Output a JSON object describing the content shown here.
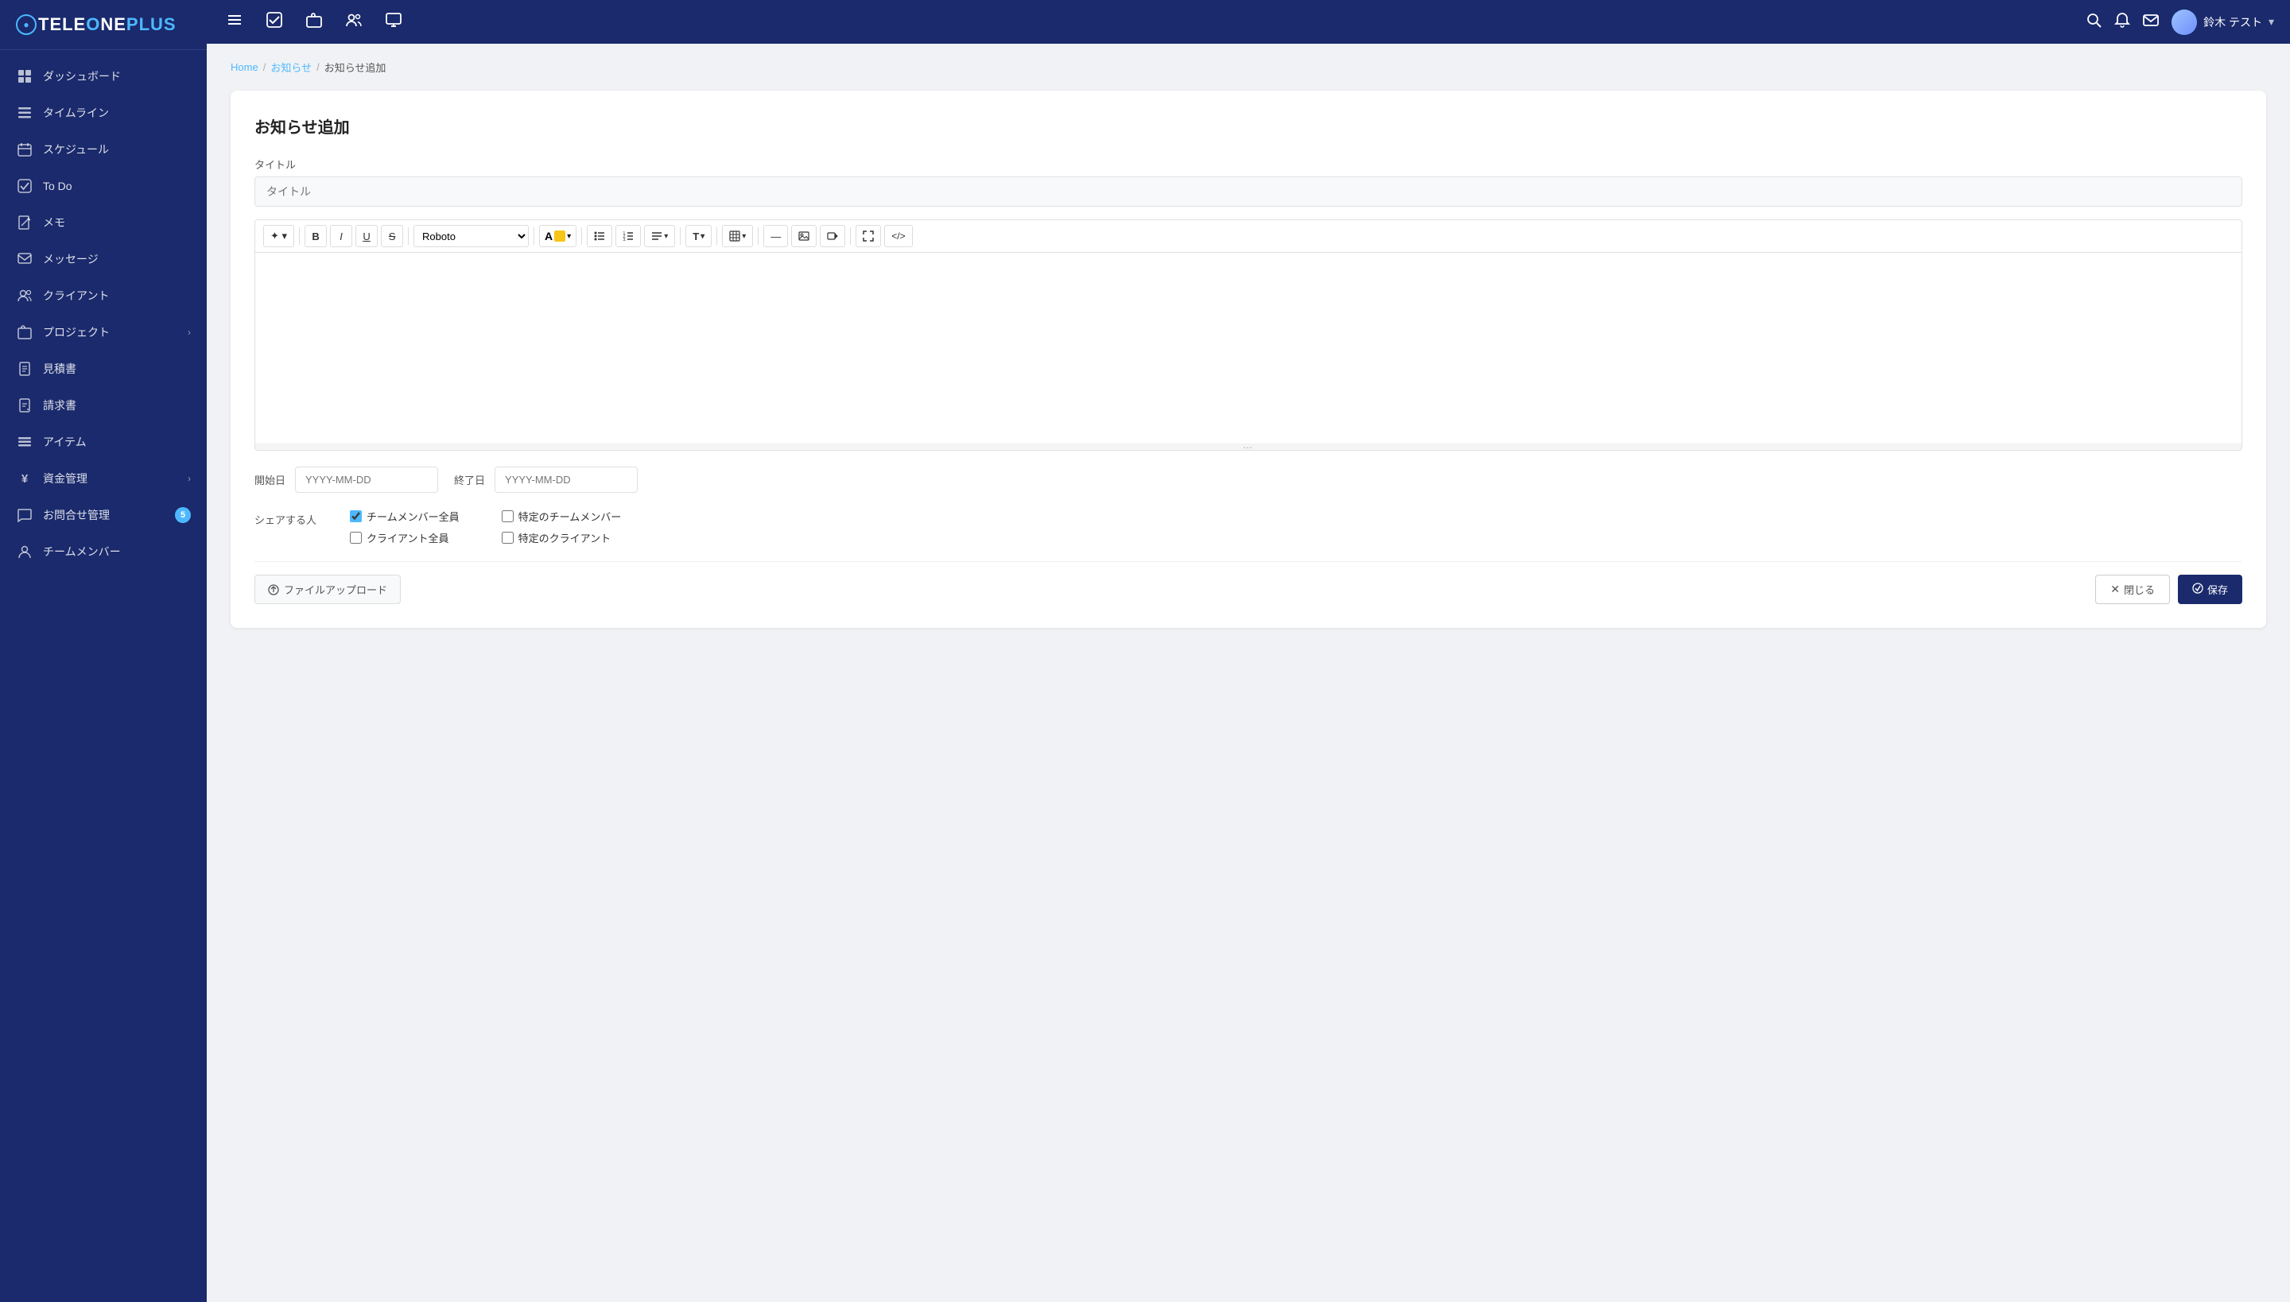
{
  "brand": {
    "name_part1": "TELE",
    "name_part2": "NE",
    "name_part3": "PLUS"
  },
  "topnav": {
    "user_name": "鈴木 テスト",
    "icons": [
      "menu",
      "check",
      "briefcase",
      "users",
      "monitor",
      "search",
      "bell",
      "mail"
    ]
  },
  "sidebar": {
    "items": [
      {
        "id": "dashboard",
        "label": "ダッシュボード",
        "icon": "⊞",
        "has_arrow": false,
        "badge": null
      },
      {
        "id": "timeline",
        "label": "タイムライン",
        "icon": "▤",
        "has_arrow": false,
        "badge": null
      },
      {
        "id": "schedule",
        "label": "スケジュール",
        "icon": "📅",
        "has_arrow": false,
        "badge": null
      },
      {
        "id": "todo",
        "label": "To Do",
        "icon": "✓",
        "has_arrow": false,
        "badge": null
      },
      {
        "id": "memo",
        "label": "メモ",
        "icon": "✎",
        "has_arrow": false,
        "badge": null
      },
      {
        "id": "message",
        "label": "メッセージ",
        "icon": "✉",
        "has_arrow": false,
        "badge": null
      },
      {
        "id": "client",
        "label": "クライアント",
        "icon": "👥",
        "has_arrow": false,
        "badge": null
      },
      {
        "id": "project",
        "label": "プロジェクト",
        "icon": "📁",
        "has_arrow": true,
        "badge": null
      },
      {
        "id": "estimate",
        "label": "見積書",
        "icon": "📄",
        "has_arrow": false,
        "badge": null
      },
      {
        "id": "invoice",
        "label": "請求書",
        "icon": "📋",
        "has_arrow": false,
        "badge": null
      },
      {
        "id": "items",
        "label": "アイテム",
        "icon": "≡",
        "has_arrow": false,
        "badge": null
      },
      {
        "id": "finance",
        "label": "資金管理",
        "icon": "¥",
        "has_arrow": true,
        "badge": null
      },
      {
        "id": "inquiry",
        "label": "お問合せ管理",
        "icon": "💬",
        "has_arrow": false,
        "badge": "5"
      },
      {
        "id": "team",
        "label": "チームメンバー",
        "icon": "👤",
        "has_arrow": false,
        "badge": null
      }
    ]
  },
  "breadcrumb": {
    "home": "Home",
    "parent": "お知らせ",
    "current": "お知らせ追加"
  },
  "form": {
    "title": "お知らせ追加",
    "title_field_label": "タイトル",
    "title_field_placeholder": "タイトル",
    "start_date_label": "開始日",
    "start_date_placeholder": "YYYY-MM-DD",
    "end_date_label": "終了日",
    "end_date_placeholder": "YYYY-MM-DD",
    "share_label": "シェアする人",
    "share_options": [
      {
        "id": "all_team",
        "label": "チームメンバー全員",
        "checked": true
      },
      {
        "id": "specific_team",
        "label": "特定のチームメンバー",
        "checked": false
      },
      {
        "id": "all_client",
        "label": "クライアント全員",
        "checked": false
      },
      {
        "id": "specific_client",
        "label": "特定のクライアント",
        "checked": false
      }
    ],
    "upload_btn": "ファイルアップロード",
    "cancel_btn": "閉じる",
    "save_btn": "保存"
  },
  "toolbar": {
    "buttons": [
      {
        "id": "magic",
        "label": "✦▾"
      },
      {
        "id": "bold",
        "label": "B"
      },
      {
        "id": "italic",
        "label": "I"
      },
      {
        "id": "underline",
        "label": "U"
      },
      {
        "id": "strikethrough",
        "label": "S"
      },
      {
        "id": "font",
        "label": "Roboto▾"
      },
      {
        "id": "font_color",
        "label": "A"
      },
      {
        "id": "bullet_list",
        "label": "☰"
      },
      {
        "id": "ordered_list",
        "label": "☷"
      },
      {
        "id": "align",
        "label": "≡▾"
      },
      {
        "id": "heading",
        "label": "T▾"
      },
      {
        "id": "table",
        "label": "⊞▾"
      },
      {
        "id": "hr",
        "label": "—"
      },
      {
        "id": "image",
        "label": "🖼"
      },
      {
        "id": "video",
        "label": "▬"
      },
      {
        "id": "fullscreen",
        "label": "⤢"
      },
      {
        "id": "source",
        "label": "</>"
      }
    ]
  },
  "colors": {
    "brand_dark": "#1a2a6c",
    "brand_accent": "#4db8ff",
    "bg_light": "#f0f2f5",
    "border": "#e0e0e0",
    "text_primary": "#222",
    "text_secondary": "#555",
    "badge": "#4db8ff"
  }
}
